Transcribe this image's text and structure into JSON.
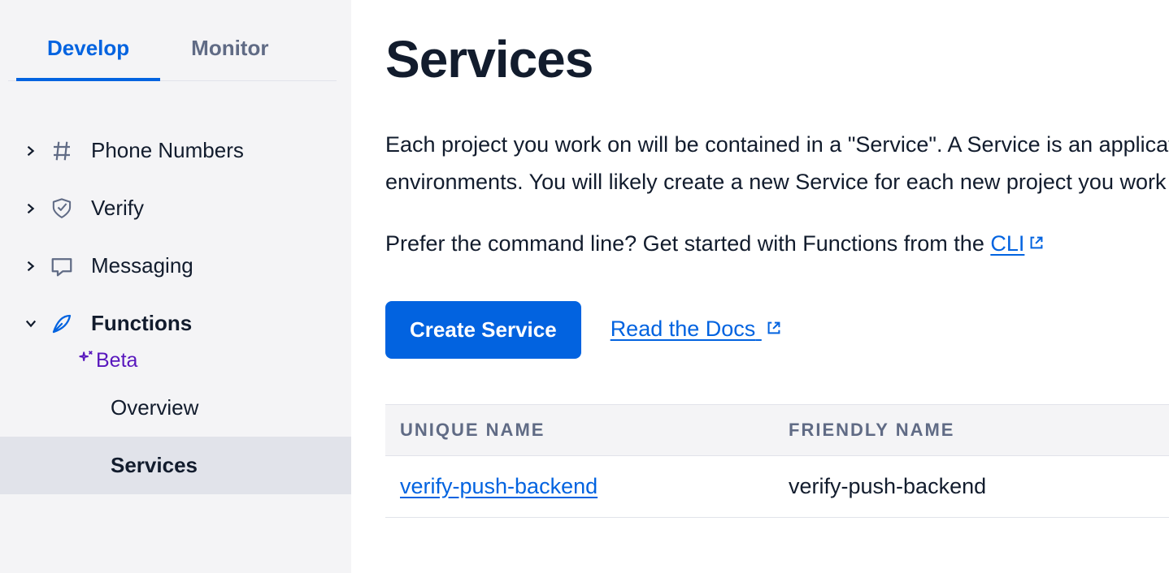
{
  "sidebar": {
    "tabs": {
      "develop": "Develop",
      "monitor": "Monitor"
    },
    "items": [
      {
        "label": "Phone Numbers"
      },
      {
        "label": "Verify"
      },
      {
        "label": "Messaging"
      },
      {
        "label": "Functions"
      }
    ],
    "beta_label": "Beta",
    "sub_items": {
      "overview": "Overview",
      "services": "Services"
    }
  },
  "main": {
    "title": "Services",
    "desc_line1": "Each project you work on will be contained in a \"Service\". A Service is an application container to store all your Functions and Assets, and used to manage deployments and separate",
    "desc_line2": "environments. You will likely create a new Service for each new project you work on.",
    "cli_prefix": "Prefer the command line? Get started with Functions from the ",
    "cli_link": "CLI",
    "create_button": "Create Service",
    "docs_link": "Read the Docs",
    "table": {
      "headers": {
        "unique_name": "Unique Name",
        "friendly_name": "Friendly Name"
      },
      "rows": [
        {
          "unique_name": "verify-push-backend",
          "friendly_name": "verify-push-backend"
        }
      ]
    }
  }
}
